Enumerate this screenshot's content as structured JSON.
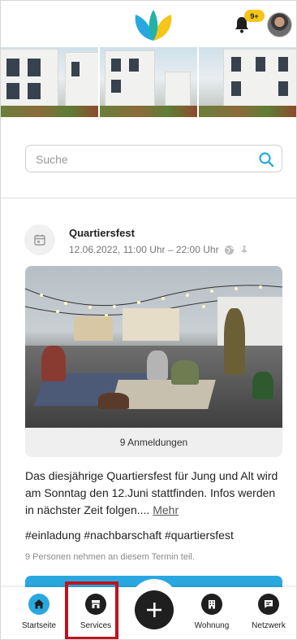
{
  "header": {
    "notification_badge": "9+"
  },
  "search": {
    "placeholder": "Suche"
  },
  "event": {
    "title": "Quartiersfest",
    "datetime": "12.06.2022, 11:00 Uhr – 22:00 Uhr",
    "registrations": "9 Anmeldungen",
    "description": "Das diesjährige Quartiersfest für Jung und Alt wird am Sonntag den 12.Juni stattfinden. Infos werden in nächster Zeit folgen....",
    "more_label": "Mehr",
    "hashtags": "#einladung #nachbarschaft #quartiersfest",
    "participants_note": "9 Personen nehmen an diesem Termin teil."
  },
  "nav": {
    "home": "Startseite",
    "services": "Services",
    "apartment": "Wohnung",
    "network": "Netzwerk"
  },
  "colors": {
    "accent": "#29a8e0",
    "badge": "#f5c518",
    "highlight": "#c0121e"
  }
}
